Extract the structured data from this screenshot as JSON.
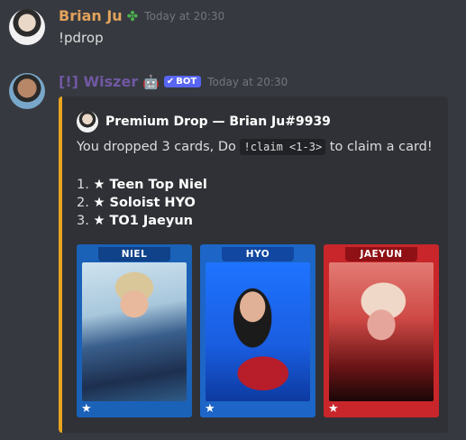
{
  "messages": [
    {
      "username": "Brian Ju",
      "badge_icon": "four-leaf-clover",
      "timestamp": "Today at 20:30",
      "content": "!pdrop"
    },
    {
      "username": "[!] Wiszer",
      "badge_icon": "robot",
      "bot_tag": "BOT",
      "timestamp": "Today at 20:30",
      "embed": {
        "accent_color": "#e8a41f",
        "author": "Premium Drop — Brian Ju#9939",
        "description_before": "You dropped 3 cards, Do ",
        "command": "!claim <1-3>",
        "description_after": " to claim a card!",
        "list": [
          {
            "num": "1.",
            "star": "★",
            "name": "Teen Top Niel"
          },
          {
            "num": "2.",
            "star": "★",
            "name": "Soloist HYO"
          },
          {
            "num": "3.",
            "star": "★",
            "name": "TO1 Jaeyun"
          }
        ],
        "cards": [
          {
            "label": "NIEL",
            "star": "★",
            "color": "#1a61b8"
          },
          {
            "label": "HYO",
            "star": "★",
            "color": "#1d66c7"
          },
          {
            "label": "JAEYUN",
            "star": "★",
            "color": "#c8262a"
          }
        ]
      }
    }
  ],
  "colors": {
    "background": "#36393f",
    "embed_background": "#2f3136",
    "user1_name": "#e2a25b",
    "user2_name": "#7058a3",
    "bot_tag": "#5865f2"
  }
}
